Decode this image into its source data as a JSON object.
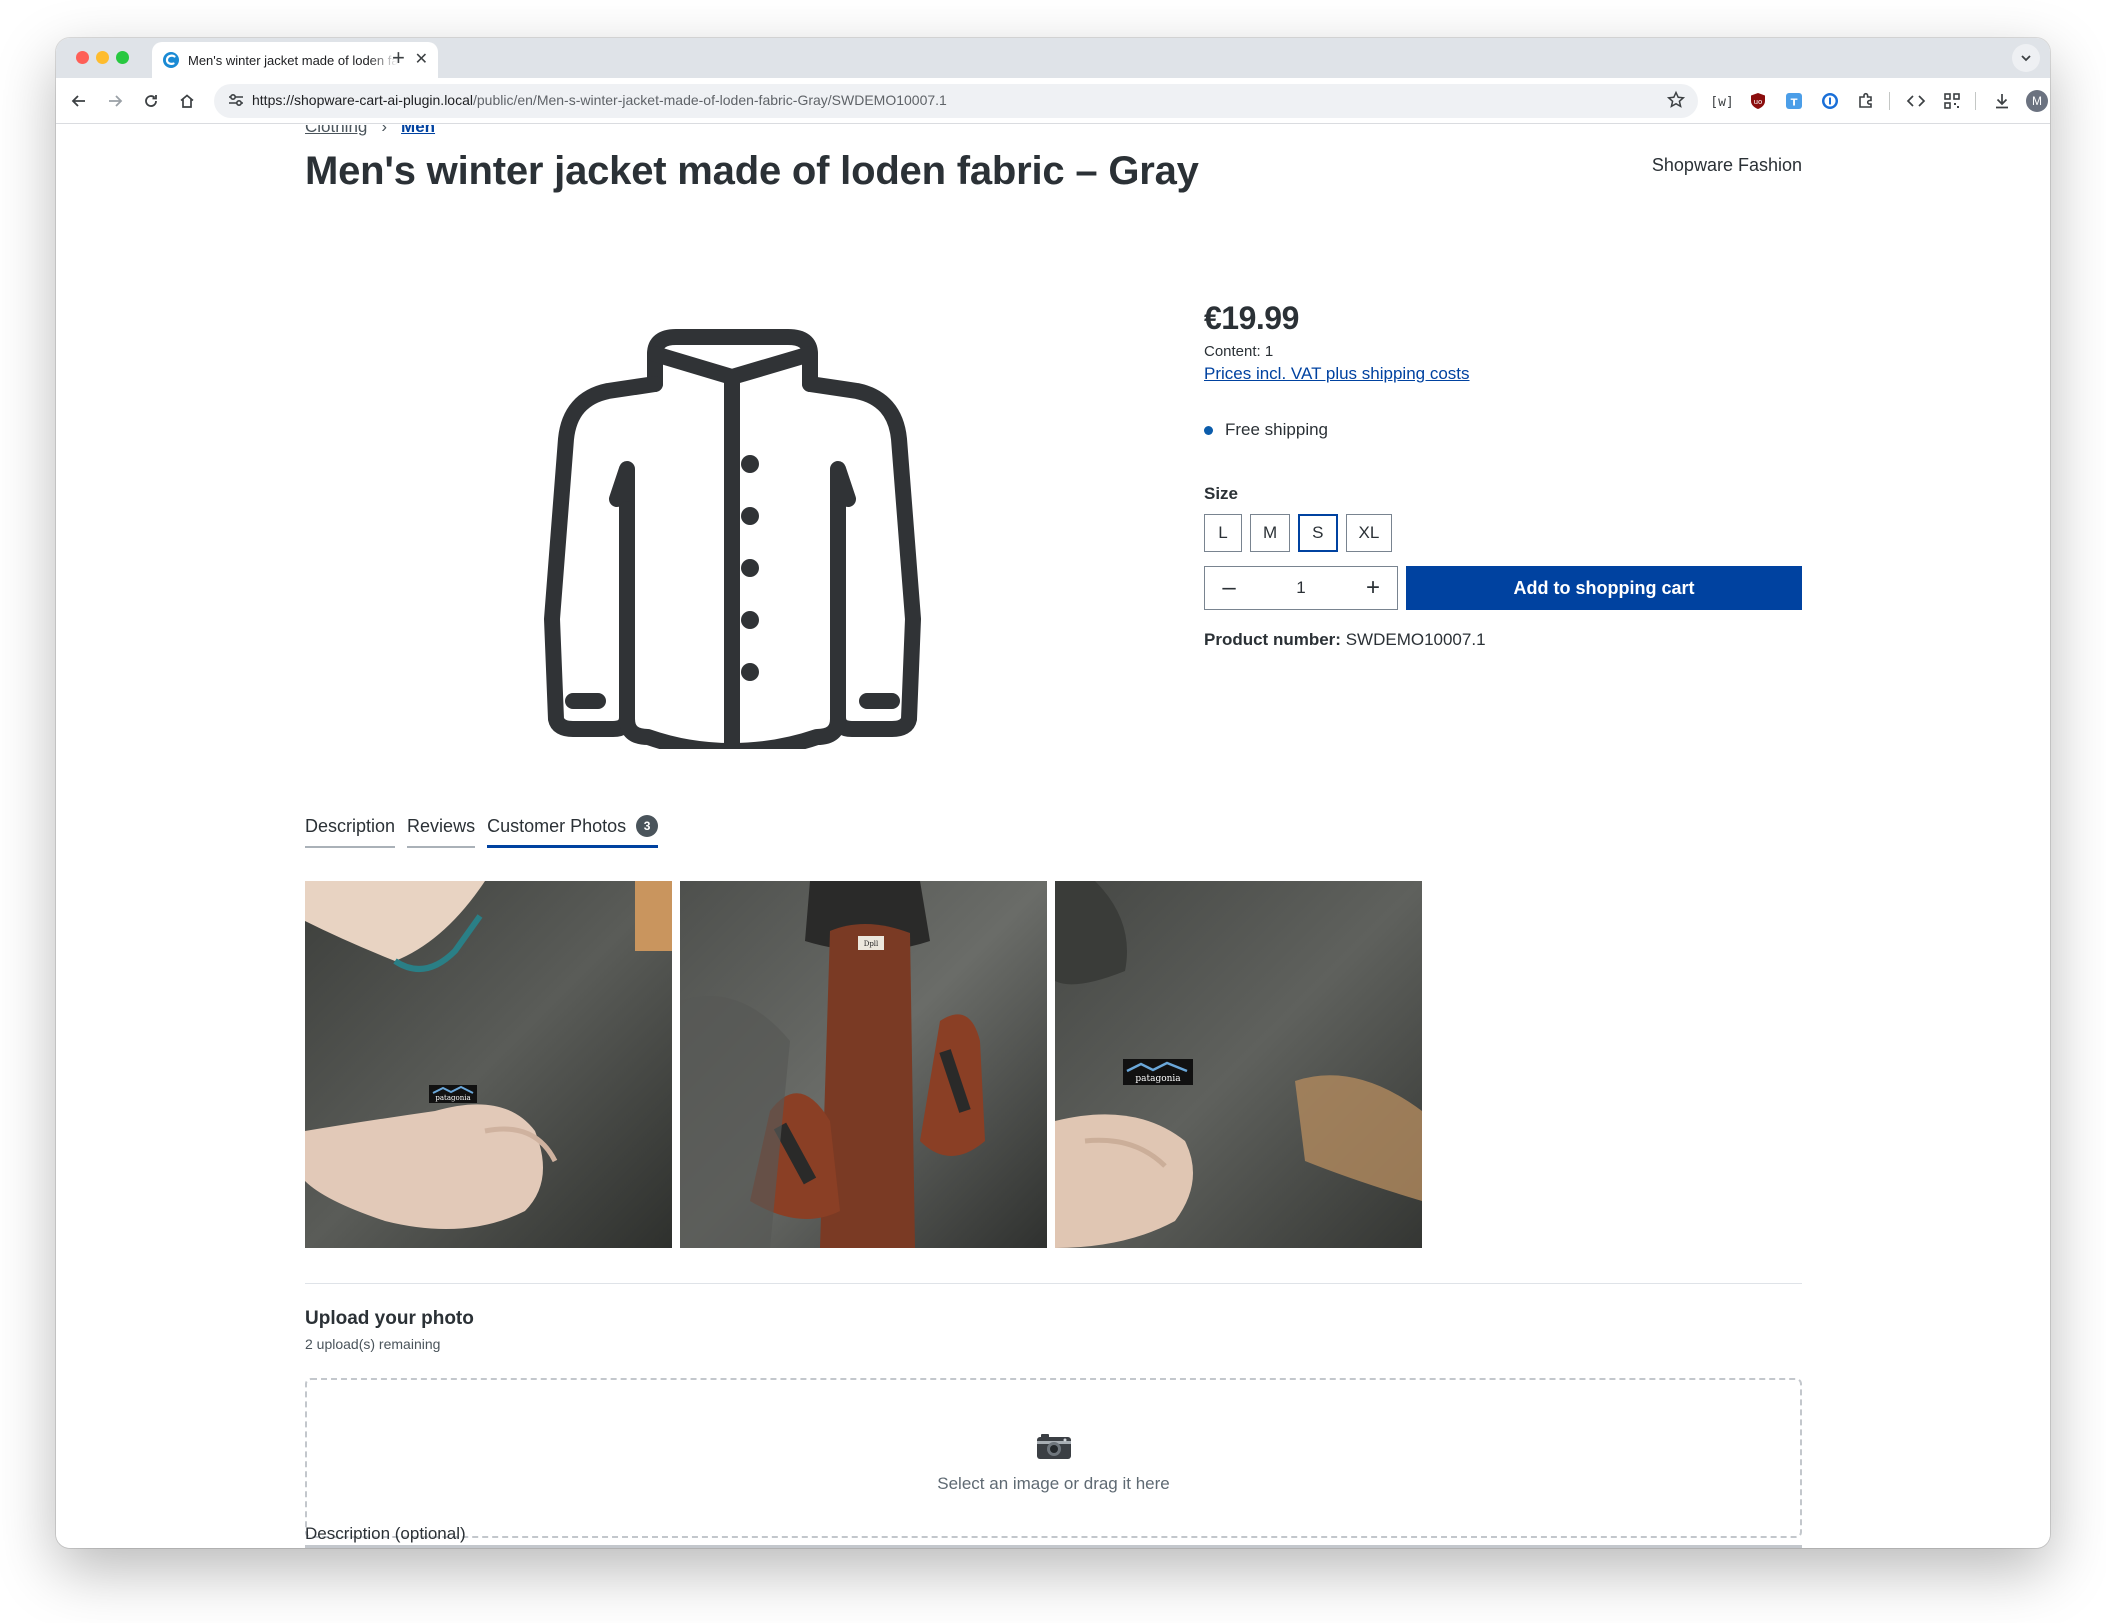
{
  "browser": {
    "tab_title": "Men's winter jacket made of loden fabric – Gray",
    "new_tab_symbol": "+",
    "close_symbol": "✕",
    "url_host": "https://shopware-cart-ai-plugin.local",
    "url_path": "/public/en/Men-s-winter-jacket-made-of-loden-fabric-Gray/SWDEMO10007.1",
    "avatar_initial": "M",
    "extensions": [
      "tab-search-icon",
      "adblock-shield-icon",
      "translate-extension-icon",
      "password-manager-icon",
      "extensions-puzzle-icon",
      "devtools-code-icon",
      "qr-code-icon"
    ]
  },
  "breadcrumb": {
    "items": [
      "Clothing",
      "Men"
    ],
    "separator": "›"
  },
  "product": {
    "title": "Men's winter jacket made of loden fabric – Gray",
    "manufacturer": "Shopware Fashion",
    "price": "€19.99",
    "content": "Content: 1",
    "tax_link": "Prices incl. VAT plus shipping costs",
    "delivery": "Free shipping",
    "size_label": "Size",
    "sizes": [
      "L",
      "M",
      "S",
      "XL"
    ],
    "selected_size": "S",
    "quantity": "1",
    "qty_minus": "–",
    "qty_plus": "+",
    "add_to_cart": "Add to shopping cart",
    "product_number_label": "Product number:",
    "product_number": "SWDEMO10007.1"
  },
  "tabs": {
    "description": "Description",
    "reviews": "Reviews",
    "customer_photos": "Customer Photos",
    "photo_count": "3"
  },
  "upload": {
    "title": "Upload your photo",
    "remaining": "2 upload(s) remaining",
    "dropzone_text": "Select an image or drag it here",
    "description_label": "Description (optional)"
  },
  "colors": {
    "brand_blue": "#0042a0",
    "text_dark": "#2b3136",
    "delivery_dot": "#0b5cab"
  }
}
